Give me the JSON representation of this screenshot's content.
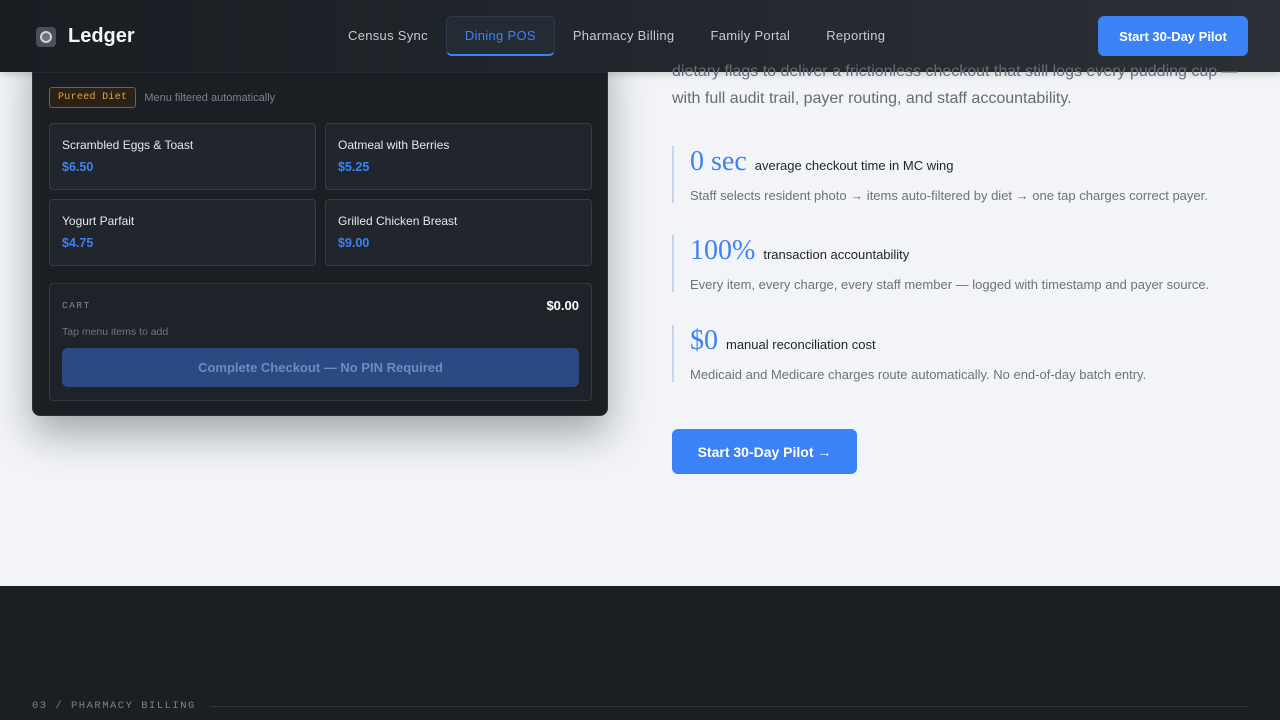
{
  "header": {
    "brand": "Ledger",
    "nav": [
      "Census Sync",
      "Dining POS",
      "Pharmacy Billing",
      "Family Portal",
      "Reporting"
    ],
    "active_nav": "Dining POS",
    "cta": "Start 30-Day Pilot"
  },
  "pos": {
    "diet_badge": "Pureed Diet",
    "diet_note": "Menu filtered automatically",
    "menu": [
      {
        "name": "Scrambled Eggs & Toast",
        "price": "$6.50"
      },
      {
        "name": "Oatmeal with Berries",
        "price": "$5.25"
      },
      {
        "name": "Yogurt Parfait",
        "price": "$4.75"
      },
      {
        "name": "Grilled Chicken Breast",
        "price": "$9.00"
      }
    ],
    "cart": {
      "label": "CART",
      "total": "$0.00",
      "hint": "Tap menu items to add",
      "checkout": "Complete Checkout — No PIN Required"
    }
  },
  "content": {
    "lead": "dietary flags to deliver a frictionless checkout that still logs every pudding cup — with full audit trail, payer routing, and staff accountability.",
    "stats": [
      {
        "value": "0 sec",
        "label": "average checkout time in MC wing",
        "desc": "Staff selects resident photo → items auto-filtered by diet → one tap charges correct payer."
      },
      {
        "value": "100%",
        "label": "transaction accountability",
        "desc": "Every item, every charge, every staff member — logged with timestamp and payer source."
      },
      {
        "value": "$0",
        "label": "manual reconciliation cost",
        "desc": "Medicaid and Medicare charges route automatically. No end-of-day batch entry."
      }
    ],
    "cta": "Start 30-Day Pilot →"
  },
  "footer": {
    "section_label": "03 / PHARMACY BILLING"
  },
  "colors": {
    "accent": "#3b82f6",
    "dark": "#1b1f24",
    "diet_badge": "#e3a33b"
  }
}
